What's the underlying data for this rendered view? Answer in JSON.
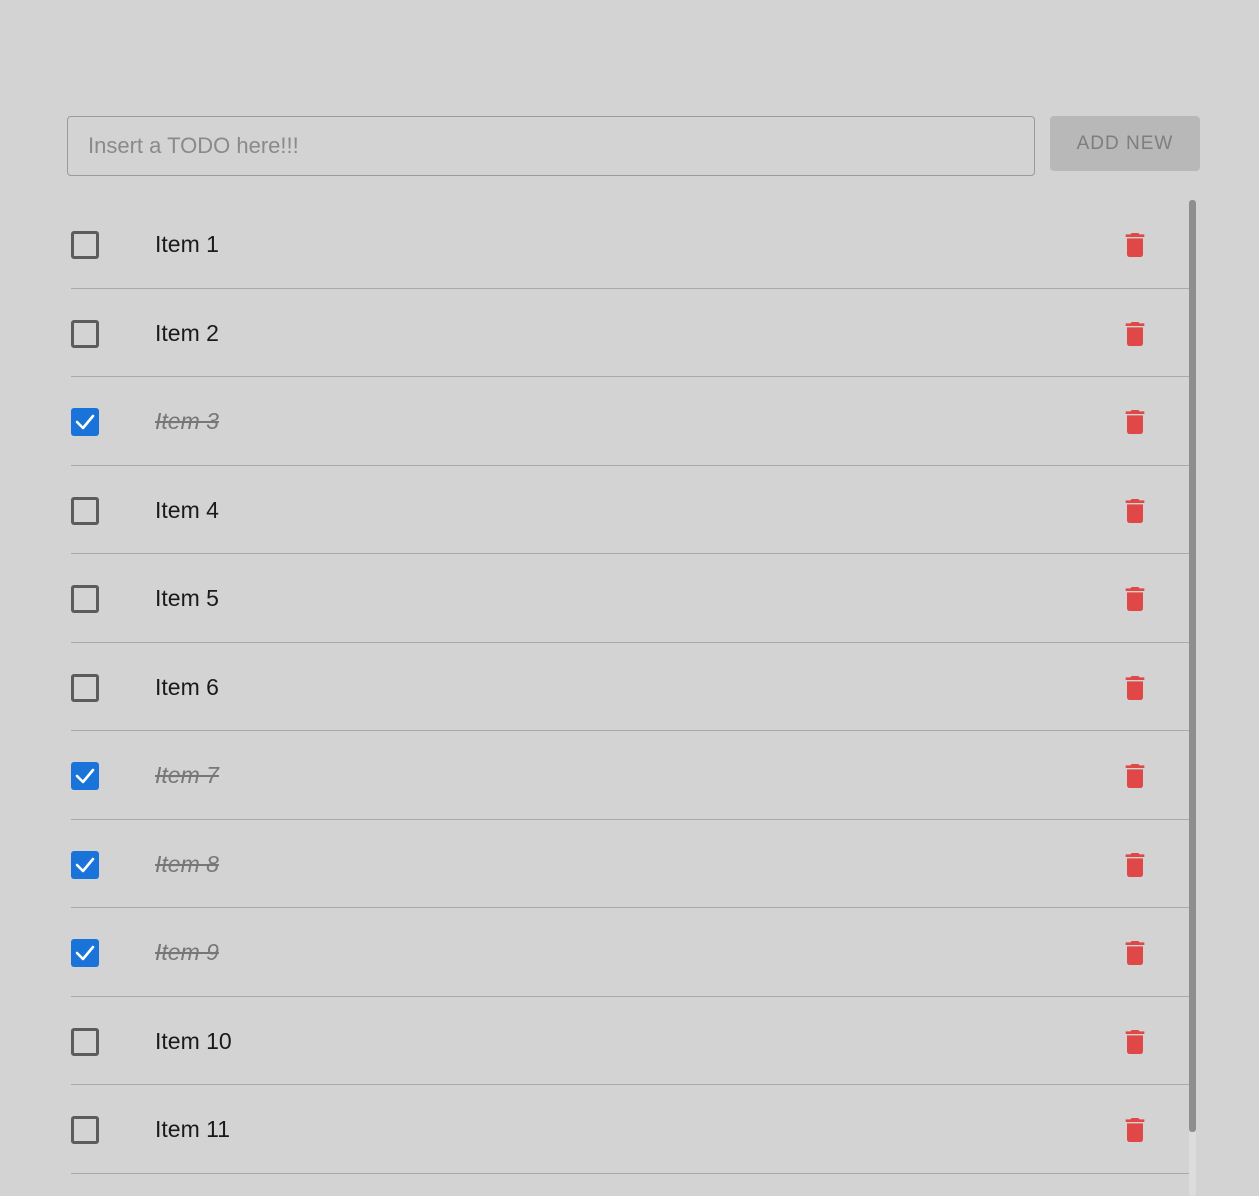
{
  "input": {
    "placeholder": "Insert a TODO here!!!",
    "value": ""
  },
  "add_button": {
    "label": "ADD NEW"
  },
  "colors": {
    "background": "#d3d3d3",
    "checkbox_checked": "#1a73d9",
    "delete_icon": "#e04848"
  },
  "items": [
    {
      "label": "Item 1",
      "done": false
    },
    {
      "label": "Item 2",
      "done": false
    },
    {
      "label": "Item 3",
      "done": true
    },
    {
      "label": "Item 4",
      "done": false
    },
    {
      "label": "Item 5",
      "done": false
    },
    {
      "label": "Item 6",
      "done": false
    },
    {
      "label": "Item 7",
      "done": true
    },
    {
      "label": "Item 8",
      "done": true
    },
    {
      "label": "Item 9",
      "done": true
    },
    {
      "label": "Item 10",
      "done": false
    },
    {
      "label": "Item 11",
      "done": false
    }
  ],
  "icons": {
    "checkbox_checked": "check-icon",
    "delete": "trash-icon"
  }
}
